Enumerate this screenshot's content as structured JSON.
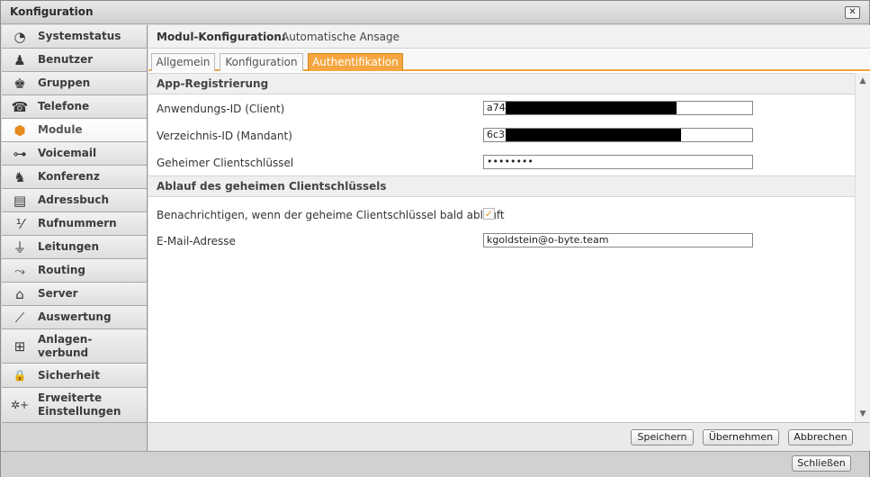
{
  "window": {
    "title": "Konfiguration",
    "close_label": "✕"
  },
  "sidebar": {
    "items": [
      {
        "label": "Systemstatus",
        "icon": "◔",
        "icon_name": "clock-icon"
      },
      {
        "label": "Benutzer",
        "icon": "♟",
        "icon_name": "user-icon"
      },
      {
        "label": "Gruppen",
        "icon": "♚",
        "icon_name": "group-icon"
      },
      {
        "label": "Telefone",
        "icon": "☎",
        "icon_name": "telephone-icon"
      },
      {
        "label": "Module",
        "icon": "⬢",
        "icon_name": "module-icon"
      },
      {
        "label": "Voicemail",
        "icon": "⊶",
        "icon_name": "voicemail-icon"
      },
      {
        "label": "Konferenz",
        "icon": "♞",
        "icon_name": "conference-icon"
      },
      {
        "label": "Adressbuch",
        "icon": "▤",
        "icon_name": "address-book-icon"
      },
      {
        "label": "Rufnummern",
        "icon": "⅟",
        "icon_name": "phone-numbers-icon"
      },
      {
        "label": "Leitungen",
        "icon": "⏚",
        "icon_name": "lines-icon"
      },
      {
        "label": "Routing",
        "icon": "⤳",
        "icon_name": "routing-icon"
      },
      {
        "label": "Server",
        "icon": "⌂",
        "icon_name": "server-icon"
      },
      {
        "label": "Auswertung",
        "icon": "⟋",
        "icon_name": "chart-icon"
      },
      {
        "label": "Anlagen-\nverbund",
        "icon": "⊞",
        "icon_name": "network-icon"
      },
      {
        "label": "Sicherheit",
        "icon": "🔒",
        "icon_name": "lock-icon"
      },
      {
        "label": "Erweiterte\nEinstellungen",
        "icon": "✲+",
        "icon_name": "settings-icon"
      }
    ]
  },
  "header": {
    "label": "Modul-Konfiguration:",
    "value": "Automatische Ansage"
  },
  "tabs": [
    "Allgemein",
    "Konfiguration",
    "Authentifikation"
  ],
  "sections": {
    "app": {
      "title": "App-Registrierung"
    },
    "expiry": {
      "title": "Ablauf des geheimen Clientschlüssels"
    }
  },
  "fields": {
    "client_id": {
      "label": "Anwendungs-ID (Client)",
      "value": "a74"
    },
    "tenant_id": {
      "label": "Verzeichnis-ID (Mandant)",
      "value": "6c3"
    },
    "secret": {
      "label": "Geheimer Clientschlüssel",
      "value": "••••••••"
    },
    "notify": {
      "label": "Benachrichtigen, wenn der geheime Clientschlüssel bald abläuft",
      "checked": "✓"
    },
    "email": {
      "label": "E-Mail-Adresse",
      "value": "kgoldstein@o-byte.team"
    }
  },
  "buttons": {
    "save": "Speichern",
    "apply": "Übernehmen",
    "cancel": "Abbrechen",
    "close": "Schließen"
  },
  "colors": {
    "accent": "#f5a640",
    "sidebar_active": "#ffffff"
  }
}
